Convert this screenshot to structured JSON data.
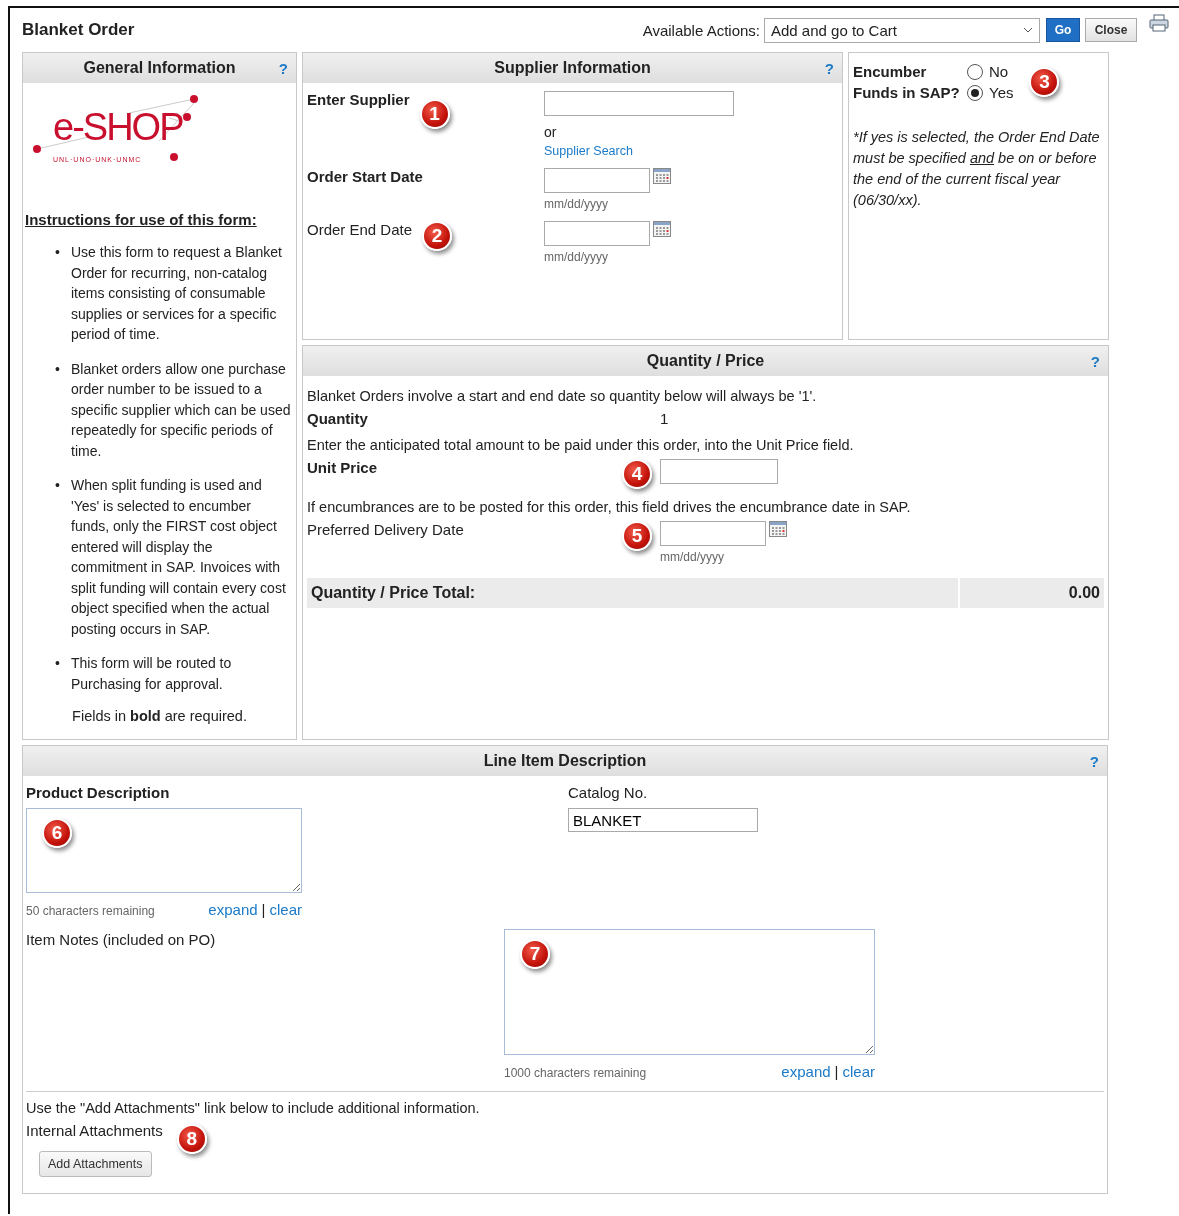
{
  "title": "Blanket Order",
  "actions": {
    "label": "Available Actions:",
    "value": "Add and go to Cart",
    "buttons": [
      "Go",
      "Close"
    ]
  },
  "general": {
    "heading": "General Information",
    "help": "?",
    "logo": {
      "wordmark": "e-SHOP",
      "tagline": "UNL·UNO·UNK·UNMC"
    },
    "instructions_heading": "Instructions for use of this form:",
    "bullet_marker": "•",
    "bullets": [
      "Use this form to request a Blanket Order for recurring, non-catalog items consisting of consumable supplies or services for a specific period of time.",
      "Blanket orders allow one purchase order number to be issued to a specific supplier which can be used repeatedly for specific periods of time.",
      "When split funding is used and 'Yes' is selected to encumber funds, only the FIRST cost object entered will display the commitment in SAP. Invoices with split funding will contain every cost object specified when the actual posting occurs in SAP.",
      "This form will be routed to Purchasing for approval."
    ],
    "required_note": "Fields in **bold** are required."
  },
  "supplier": {
    "heading": "Supplier Information",
    "help": "?",
    "fields": [
      {
        "kind": "supplier",
        "label": "Enter Supplier",
        "required": true,
        "badge": "1",
        "or": "or",
        "link": "Supplier Search"
      },
      {
        "kind": "date",
        "label": "Order Start Date",
        "required": true,
        "hint": "mm/dd/yyyy"
      },
      {
        "kind": "date",
        "label": "Order End Date",
        "required": false,
        "badge": "2",
        "hint": "mm/dd/yyyy"
      }
    ]
  },
  "encumber": {
    "label": "Encumber Funds in SAP?",
    "options": [
      {
        "label": "No",
        "selected": false
      },
      {
        "label": "Yes",
        "selected": true
      }
    ],
    "badge": "3",
    "note": [
      "*If yes is selected, the Order End Date must be specified ",
      "and",
      " be on or before the end of the current fiscal year (06/30/xx)."
    ]
  },
  "quantity": {
    "heading": "Quantity / Price",
    "help": "?",
    "items": [
      {
        "kind": "note",
        "text": "Blanket Orders involve a start and end date so quantity below will always be '1'."
      },
      {
        "kind": "value",
        "label": "Quantity",
        "required": true,
        "value": "1"
      },
      {
        "kind": "note",
        "text": "Enter the anticipated total amount to be paid under this order, into the Unit Price field."
      },
      {
        "kind": "input",
        "label": "Unit Price",
        "required": true,
        "badge": "4"
      },
      {
        "kind": "note",
        "text": "If encumbrances are to be posted for this order, this field drives the encumbrance date in SAP."
      },
      {
        "kind": "date",
        "label": "Preferred Delivery Date",
        "required": false,
        "badge": "5",
        "hint": "mm/dd/yyyy"
      }
    ],
    "total": {
      "label": "Quantity / Price Total:",
      "value": "0.00"
    }
  },
  "line_item": {
    "heading": "Line Item Description",
    "help": "?",
    "product": {
      "label": "Product Description",
      "badge": "6",
      "remaining": "50 characters remaining",
      "links": [
        "expand",
        "clear"
      ],
      "separator": "|"
    },
    "catalog": {
      "label": "Catalog No.",
      "value": "BLANKET"
    },
    "notes": {
      "label": "Item Notes (included on PO)",
      "badge": "7",
      "remaining": "1000 characters remaining",
      "links": [
        "expand",
        "clear"
      ],
      "separator": "|"
    },
    "attachments": {
      "note": "Use the \"Add Attachments\" link below to include additional information.",
      "label": "Internal Attachments",
      "badge": "8",
      "button": "Add Attachments"
    }
  }
}
